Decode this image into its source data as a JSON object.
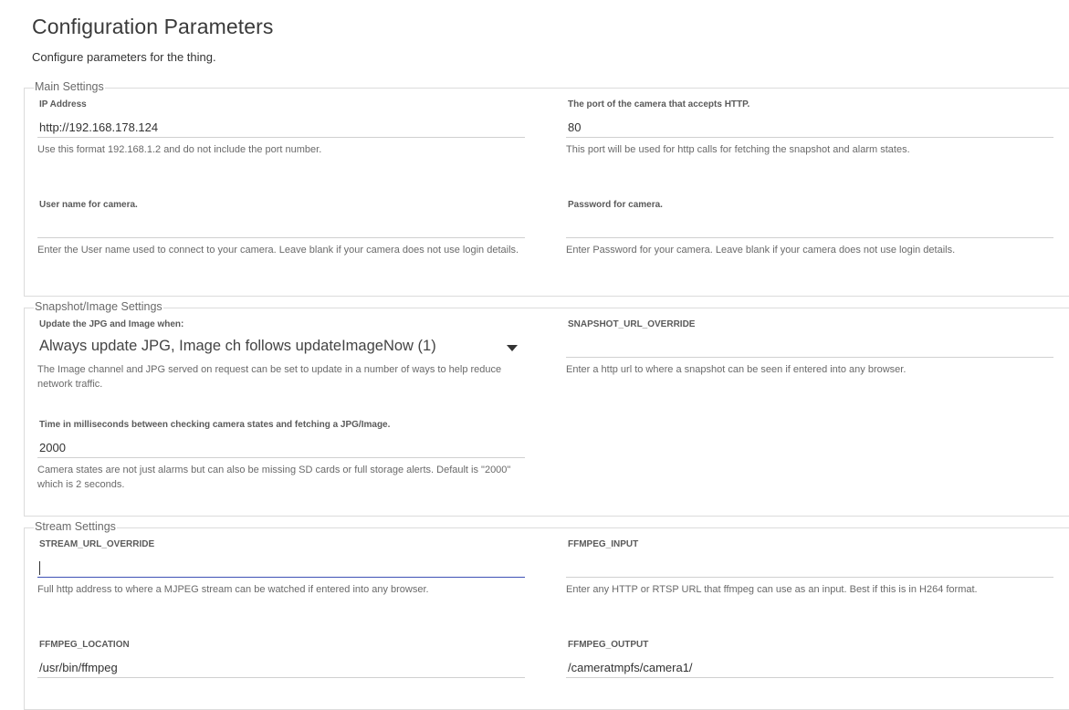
{
  "page": {
    "title": "Configuration Parameters",
    "subtitle": "Configure parameters for the thing."
  },
  "main_settings": {
    "legend": "Main Settings",
    "ip_address": {
      "label": "IP Address",
      "value": "http://192.168.178.124",
      "help": "Use this format 192.168.1.2 and do not include the port number."
    },
    "port": {
      "label": "The port of the camera that accepts HTTP.",
      "value": "80",
      "help": "This port will be used for http calls for fetching the snapshot and alarm states."
    },
    "username": {
      "label": "User name for camera.",
      "value": "",
      "help": "Enter the User name used to connect to your camera. Leave blank if your camera does not use login details."
    },
    "password": {
      "label": "Password for camera.",
      "value": "",
      "help": "Enter Password for your camera. Leave blank if your camera does not use login details."
    }
  },
  "snapshot_settings": {
    "legend": "Snapshot/Image Settings",
    "update_mode": {
      "label": "Update the JPG and Image when:",
      "selected": "Always update JPG, Image ch follows updateImageNow (1)",
      "help": "The Image channel and JPG served on request can be set to update in a number of ways to help reduce network traffic."
    },
    "snapshot_url_override": {
      "label": "SNAPSHOT_URL_OVERRIDE",
      "value": "",
      "help": "Enter a http url to where a snapshot can be seen if entered into any browser."
    },
    "poll_time": {
      "label": "Time in milliseconds between checking camera states and fetching a JPG/Image.",
      "value": "2000",
      "help": "Camera states are not just alarms but can also be missing SD cards or full storage alerts. Default is \"2000\" which is 2 seconds."
    }
  },
  "stream_settings": {
    "legend": "Stream Settings",
    "stream_url_override": {
      "label": "STREAM_URL_OVERRIDE",
      "value": "",
      "help": "Full http address to where a MJPEG stream can be watched if entered into any browser."
    },
    "ffmpeg_input": {
      "label": "FFMPEG_INPUT",
      "value": "",
      "help": "Enter any HTTP or RTSP URL that ffmpeg can use as an input. Best if this is in H264 format."
    },
    "ffmpeg_location": {
      "label": "FFMPEG_LOCATION",
      "value": "/usr/bin/ffmpeg"
    },
    "ffmpeg_output": {
      "label": "FFMPEG_OUTPUT",
      "value": "/cameratmpfs/camera1/"
    }
  },
  "colors": {
    "focus_underline": "#3f51b5",
    "border": "#dcdcdc"
  }
}
